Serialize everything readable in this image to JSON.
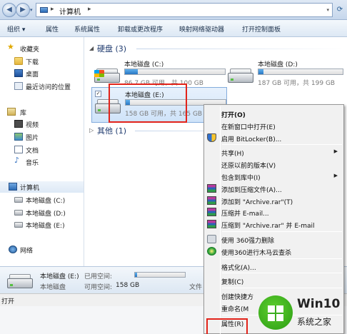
{
  "address": {
    "location": "计算机",
    "separator": "▸"
  },
  "toolbar": [
    "组织 ▾",
    "属性",
    "系统属性",
    "卸载或更改程序",
    "映射网络驱动器",
    "打开控制面板"
  ],
  "nav": {
    "favorites": "收藏夹",
    "downloads": "下载",
    "desktop": "桌面",
    "recent": "最近访问的位置",
    "libraries": "库",
    "videos": "视频",
    "pictures": "图片",
    "documents": "文档",
    "music": "音乐",
    "computer": "计算机",
    "drive_c": "本地磁盘 (C:)",
    "drive_d": "本地磁盘 (D:)",
    "drive_e": "本地磁盘 (E:)",
    "network": "网络"
  },
  "content": {
    "hdd_group": "硬盘 (3)",
    "other_group": "其他 (1)",
    "drives": [
      {
        "name": "本地磁盘 (C:)",
        "space": "86.7 GB 可用，共 100 GB",
        "used_fraction": 0.13
      },
      {
        "name": "本地磁盘 (D:)",
        "space": "187 GB 可用，共 199 GB",
        "used_fraction": 0.06
      },
      {
        "name": "本地磁盘 (E:)",
        "space": "158 GB 可用，共 165 GB",
        "used_fraction": 0.04,
        "checkbox": "✓"
      }
    ]
  },
  "details": {
    "name": "本地磁盘 (E:)",
    "type": "本地磁盘",
    "used_label": "已用空间:",
    "free_label": "可用空间:",
    "free_value": "158 GB",
    "fs_partial": "文件",
    "used_fraction": 0.04
  },
  "status": "打开",
  "context_menu": [
    {
      "label": "打开(O)",
      "bold": true
    },
    {
      "label": "在新窗口中打开(E)"
    },
    {
      "label": "启用 BitLocker(B)...",
      "icon": "shield-icon"
    },
    {
      "separator": true
    },
    {
      "label": "共享(H)",
      "submenu": true
    },
    {
      "label": "还原以前的版本(V)"
    },
    {
      "label": "包含到库中(I)",
      "submenu": true
    },
    {
      "label": "添加到压缩文件(A)...",
      "icon": "winrar-icon"
    },
    {
      "label": "添加到 \"Archive.rar\"(T)",
      "icon": "winrar-icon"
    },
    {
      "label": "压缩并 E-mail...",
      "icon": "winrar-icon"
    },
    {
      "label": "压缩到 \"Archive.rar\" 并 E-mail",
      "icon": "winrar-icon"
    },
    {
      "separator": true
    },
    {
      "label": "使用 360强力删除",
      "icon": "360-delete-icon"
    },
    {
      "label": "使用360进行木马云查杀",
      "icon": "360-scan-icon"
    },
    {
      "separator": true
    },
    {
      "label": "格式化(A)..."
    },
    {
      "separator": true
    },
    {
      "label": "复制(C)"
    },
    {
      "separator": true
    },
    {
      "label": "创建快捷方"
    },
    {
      "label": "重命名(M"
    },
    {
      "separator": true
    },
    {
      "label": "属性(R)"
    }
  ],
  "watermark": {
    "title": "Win10",
    "subtitle": "系统之家"
  },
  "colors": {
    "highlight_box": "#e2231a",
    "bar_fill": "#2876c2",
    "selected_tile": "#cfe3f9"
  }
}
